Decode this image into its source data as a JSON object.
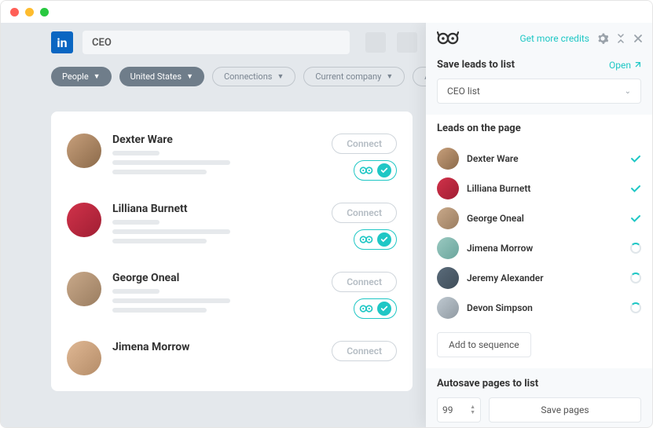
{
  "header": {
    "search_value": "CEO"
  },
  "filters": {
    "people": "People",
    "location": "United States",
    "connections": "Connections",
    "company": "Current company",
    "all": "All fil"
  },
  "results": {
    "connect_label": "Connect",
    "people": [
      {
        "name": "Dexter Ware"
      },
      {
        "name": "Lilliana Burnett"
      },
      {
        "name": "George Oneal"
      },
      {
        "name": "Jimena Morrow"
      }
    ]
  },
  "panel": {
    "credits": "Get more credits",
    "save_title": "Save leads to list",
    "open": "Open",
    "list_name": "CEO list",
    "leads_title": "Leads on the page",
    "leads": [
      {
        "name": "Dexter Ware",
        "status": "done"
      },
      {
        "name": "Lilliana Burnett",
        "status": "done"
      },
      {
        "name": "George Oneal",
        "status": "done"
      },
      {
        "name": "Jimena Morrow",
        "status": "loading"
      },
      {
        "name": "Jeremy Alexander",
        "status": "loading"
      },
      {
        "name": "Devon Simpson",
        "status": "loading"
      }
    ],
    "add_sequence": "Add to sequence",
    "autosave_title": "Autosave pages to list",
    "autosave_count": "99",
    "save_pages": "Save pages"
  }
}
